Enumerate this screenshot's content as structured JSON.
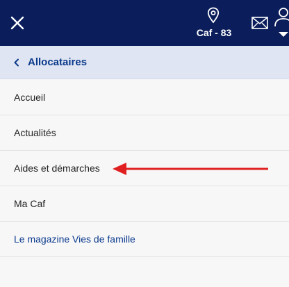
{
  "header": {
    "close_icon": "close-icon",
    "location_label": "Caf - 83",
    "location_icon": "map-pin-icon",
    "mail_icon": "mail-icon",
    "account_icon": "user-icon",
    "bg_color": "#0b1e5b"
  },
  "back": {
    "label": "Allocataires",
    "icon": "chevron-left-icon"
  },
  "menu": {
    "items": [
      {
        "label": "Accueil"
      },
      {
        "label": "Actualités"
      },
      {
        "label": "Aides et démarches"
      },
      {
        "label": "Ma Caf"
      },
      {
        "label": "Le magazine Vies de famille"
      }
    ]
  },
  "annotation": {
    "arrow_color": "#e02020",
    "icon": "arrow-left-icon"
  }
}
